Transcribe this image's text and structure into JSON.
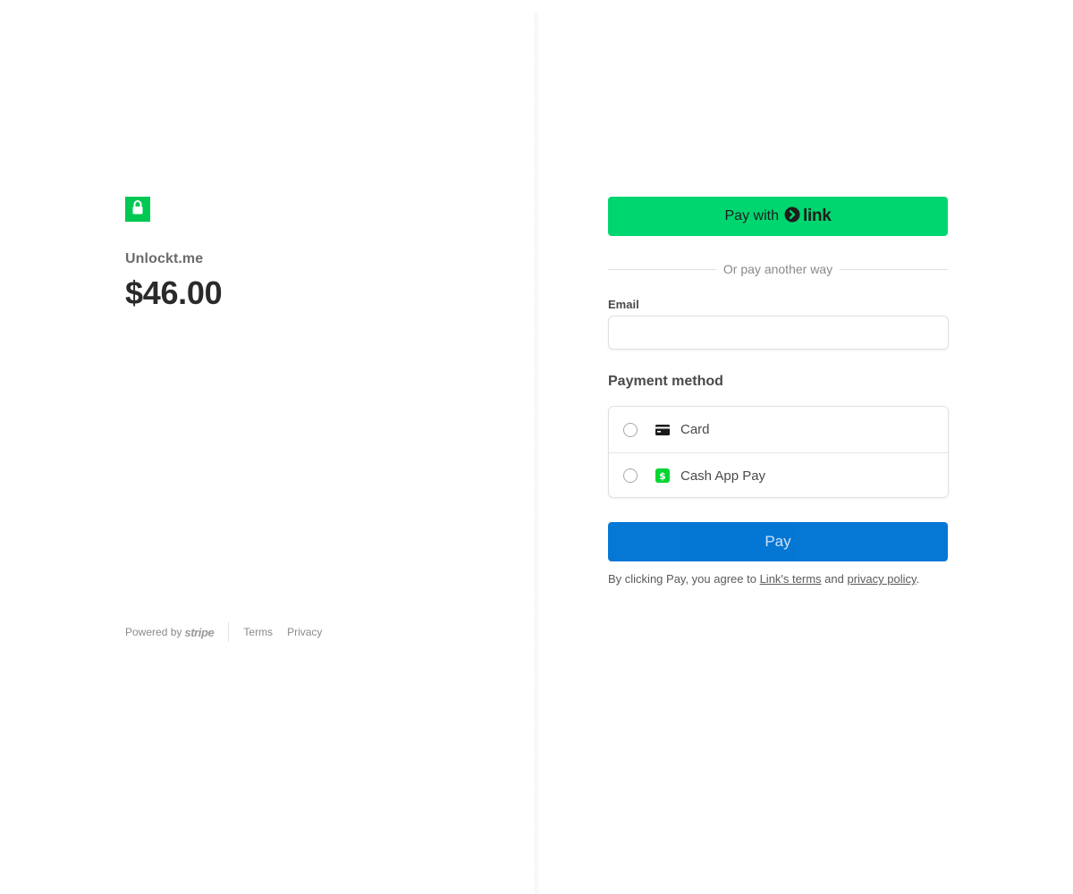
{
  "merchant": {
    "logo_icon": "lock-icon",
    "logo_color": "#00c853",
    "name": "Unlockt.me",
    "amount": "$46.00"
  },
  "footer": {
    "powered_by": "Powered by",
    "stripe": "stripe",
    "terms": "Terms",
    "privacy": "Privacy"
  },
  "express": {
    "pay_with": "Pay with",
    "link_brand": "link",
    "color": "#00d66f"
  },
  "divider_text": "Or pay another way",
  "email": {
    "label": "Email",
    "value": "",
    "placeholder": ""
  },
  "payment_method": {
    "heading": "Payment method",
    "options": [
      {
        "label": "Card",
        "icon": "credit-card-icon",
        "selected": false
      },
      {
        "label": "Cash App Pay",
        "icon": "cash-app-icon",
        "selected": false
      }
    ]
  },
  "pay_button": {
    "label": "Pay",
    "color": "#0074d4"
  },
  "agreement": {
    "prefix": "By clicking Pay, you agree to",
    "link_terms": "Link's terms",
    "and": "and",
    "privacy_policy": "privacy policy",
    "suffix": "."
  }
}
